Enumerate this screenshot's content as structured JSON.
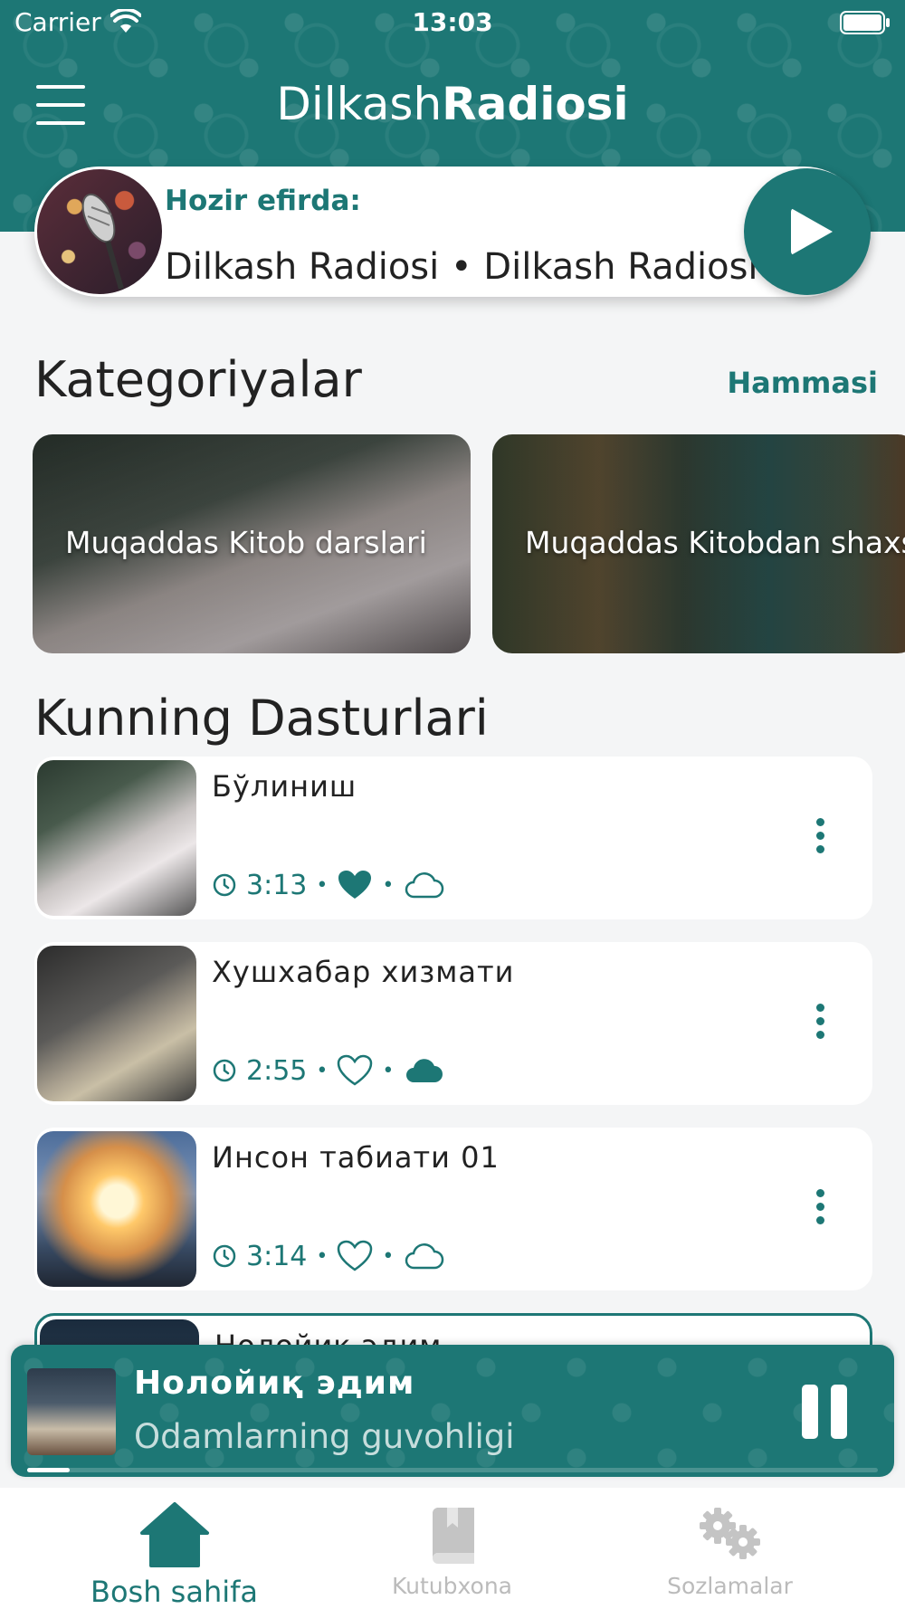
{
  "status_bar": {
    "carrier": "Carrier",
    "time": "13:03"
  },
  "header": {
    "title_light": "Dilkash",
    "title_bold": "Radiosi"
  },
  "on_air": {
    "label": "Hozir efirda:",
    "marquee": "Dilkash Radiosi • Dilkash Radiosi"
  },
  "categories": {
    "title": "Kategoriyalar",
    "see_all": "Hammasi",
    "items": [
      {
        "label": "Muqaddas Kitob darslari"
      },
      {
        "label": "Muqaddas Kitobdan shaxslar"
      }
    ]
  },
  "programs": {
    "title": "Kunning Dasturlari",
    "items": [
      {
        "title": "Бўлиниш",
        "duration": "3:13",
        "favorite": true,
        "downloaded": false
      },
      {
        "title": "Хушхабар хизмати",
        "duration": "2:55",
        "favorite": false,
        "downloaded": true
      },
      {
        "title": "Инсон табиати 01",
        "duration": "3:14",
        "favorite": false,
        "downloaded": false
      },
      {
        "title": "Нолойиқ эдим"
      }
    ]
  },
  "mini_player": {
    "title": "Нолойиқ эдим",
    "subtitle": "Odamlarning guvohligi",
    "progress": 0.05
  },
  "tabs": [
    {
      "label": "Bosh sahifa",
      "icon": "home-icon",
      "active": true
    },
    {
      "label": "Kutubxona",
      "icon": "library-icon",
      "active": false
    },
    {
      "label": "Sozlamalar",
      "icon": "settings-icon",
      "active": false
    }
  ],
  "colors": {
    "accent": "#1d7775",
    "background": "#f4f5f6",
    "inactive": "#bbbbbb"
  }
}
